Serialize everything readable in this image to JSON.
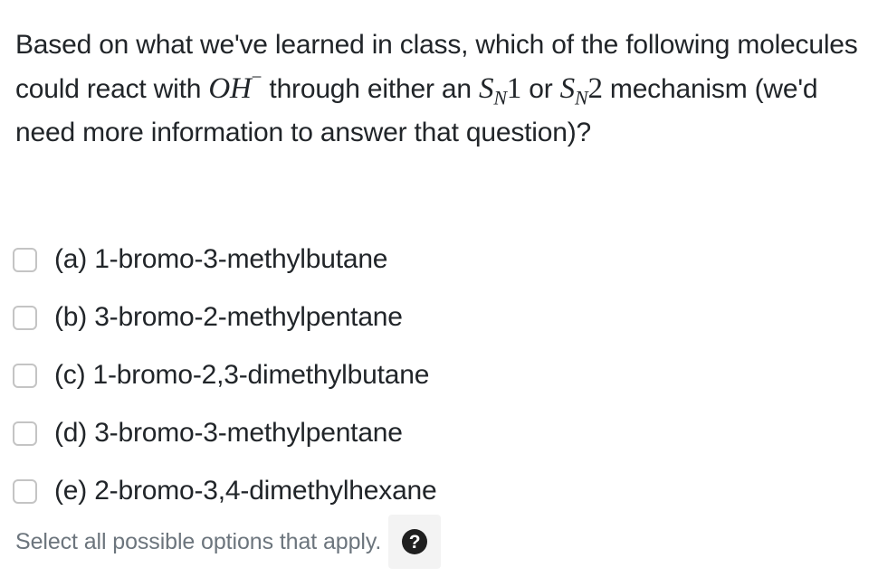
{
  "question": {
    "part1": "Based on what we've learned in class, which of the following molecules could react with ",
    "math_oh": "OH",
    "math_oh_sup": "−",
    "part2": " through either an ",
    "math_s1": "S",
    "math_s1_sub": "N",
    "math_s1_num": "1",
    "part3": " or ",
    "math_s2": "S",
    "math_s2_sub": "N",
    "math_s2_num": "2",
    "part4": " mechanism (we'd need more information to answer that question)?"
  },
  "options": [
    {
      "label": "(a) 1-bromo-3-methylbutane",
      "checked": false
    },
    {
      "label": "(b) 3-bromo-2-methylpentane",
      "checked": false
    },
    {
      "label": "(c) 1-bromo-2,3-dimethylbutane",
      "checked": false
    },
    {
      "label": "(d) 3-bromo-3-methylpentane",
      "checked": false
    },
    {
      "label": "(e) 2-bromo-3,4-dimethylhexane",
      "checked": false
    }
  ],
  "help": {
    "text": "Select all possible options that apply.",
    "icon": "question-circle-icon",
    "icon_glyph": "?"
  }
}
